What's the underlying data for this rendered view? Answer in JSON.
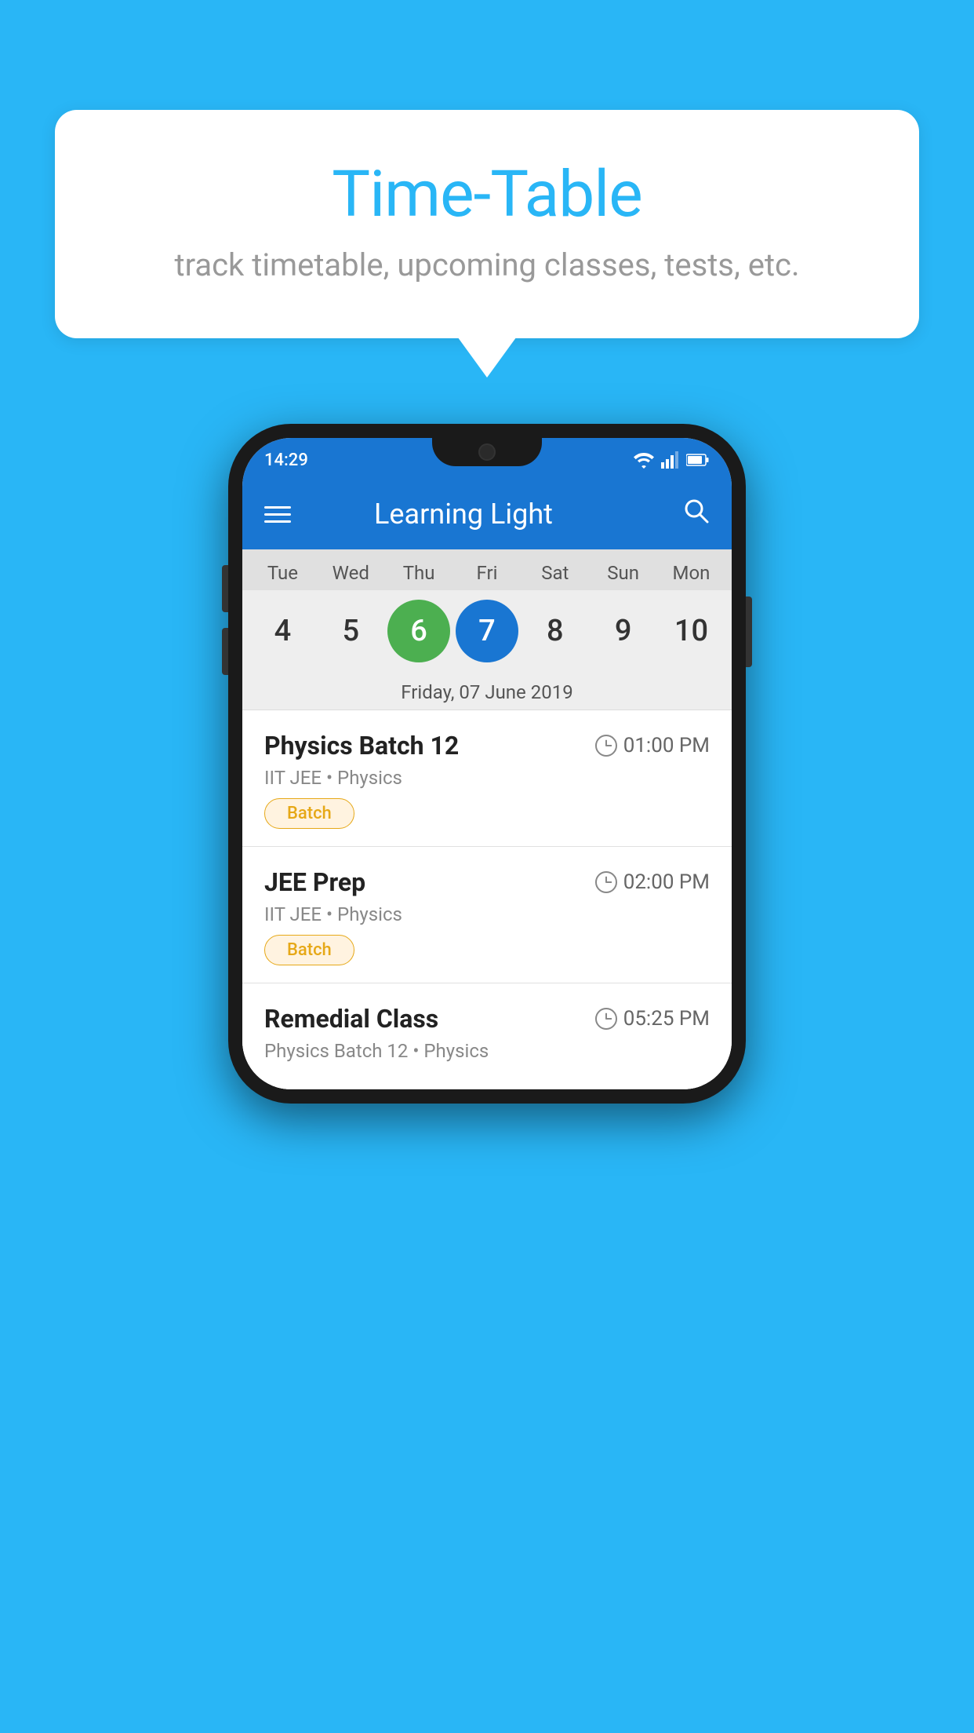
{
  "background": {
    "color": "#29B6F6"
  },
  "bubble": {
    "title": "Time-Table",
    "subtitle": "track timetable, upcoming classes, tests, etc."
  },
  "phone": {
    "status_bar": {
      "time": "14:29"
    },
    "app_bar": {
      "title": "Learning Light",
      "menu_icon": "menu-icon",
      "search_icon": "search-icon"
    },
    "calendar": {
      "days": [
        "Tue",
        "Wed",
        "Thu",
        "Fri",
        "Sat",
        "Sun",
        "Mon"
      ],
      "dates": [
        "4",
        "5",
        "6",
        "7",
        "8",
        "9",
        "10"
      ],
      "today_index": 2,
      "selected_index": 3,
      "selected_date_label": "Friday, 07 June 2019"
    },
    "schedule": [
      {
        "title": "Physics Batch 12",
        "time": "01:00 PM",
        "subtitle": "IIT JEE • Physics",
        "badge": "Batch"
      },
      {
        "title": "JEE Prep",
        "time": "02:00 PM",
        "subtitle": "IIT JEE • Physics",
        "badge": "Batch"
      },
      {
        "title": "Remedial Class",
        "time": "05:25 PM",
        "subtitle": "Physics Batch 12 • Physics",
        "badge": ""
      }
    ]
  }
}
